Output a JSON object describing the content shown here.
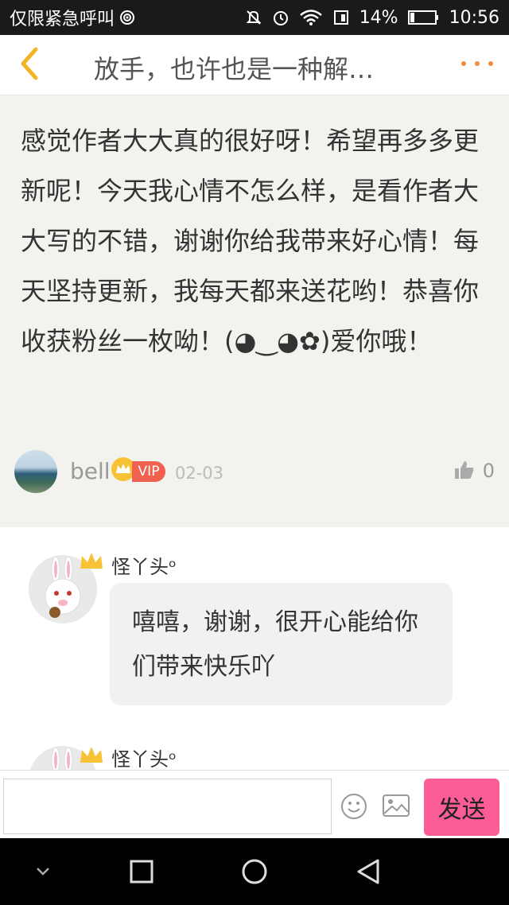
{
  "status_bar": {
    "carrier": "仅限紧急呼叫",
    "battery": "14%",
    "time": "10:56"
  },
  "header": {
    "title": "放手，也许也是一种解…"
  },
  "post": {
    "text": "感觉作者大大真的很好呀！希望再多多更新呢！今天我心情不怎么样，是看作者大大写的不错，谢谢你给我带来好心情！每天坚持更新，我每天都来送花哟！恭喜你收获粉丝一枚呦！(◕‿◕✿)爱你哦！",
    "author": "bell",
    "badge": "VIP",
    "date": "02-03",
    "likes": "0"
  },
  "replies": [
    {
      "name": "怪丫头ᵒ",
      "text": "嘻嘻，谢谢，很开心能给你们带来快乐吖"
    },
    {
      "name": "怪丫头ᵒ"
    }
  ],
  "input_bar": {
    "placeholder": "",
    "send_label": "发送"
  },
  "colors": {
    "accent": "#f08a3c",
    "send_button": "#fc5d96",
    "vip": "#f0614f",
    "post_background": "#f2f3ee"
  }
}
